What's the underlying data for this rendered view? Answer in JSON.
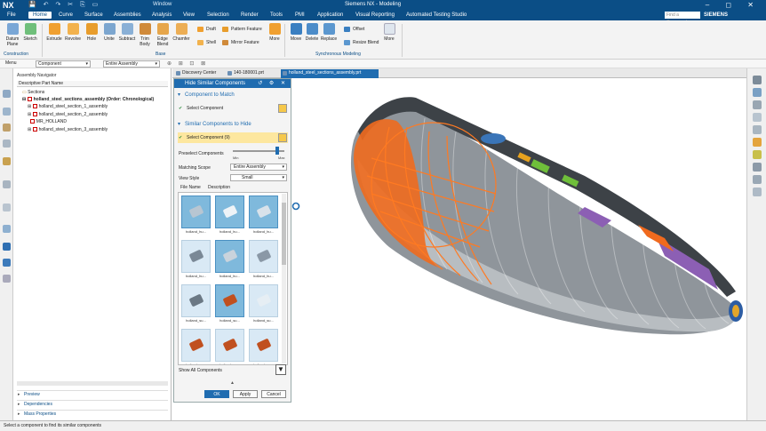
{
  "titlebar": {
    "logo": "NX",
    "window_menu": "Window",
    "title": "Siemens NX - Modeling",
    "controls": "– ◻ ✕"
  },
  "menubar": {
    "items": [
      "File",
      "Home",
      "Curve",
      "Surface",
      "Assemblies",
      "Analysis",
      "View",
      "Selection",
      "Render",
      "Tools",
      "PMI",
      "Application",
      "Visual Reporting",
      "Automated Testing Studio"
    ],
    "active": "Home",
    "search_placeholder": "Find a Command",
    "brand": "SIEMENS"
  },
  "ribbon": {
    "construction": {
      "label": "Construction",
      "items": [
        "Datum Plane",
        "Sketch"
      ]
    },
    "base": {
      "label": "Base",
      "items": [
        "Extrude",
        "Revolve",
        "Hole",
        "Unite",
        "Subtract",
        "Trim Body",
        "Edge Blend",
        "Chamfer"
      ],
      "small": [
        "Draft",
        "Shell",
        "Pattern Feature",
        "Mirror Feature"
      ],
      "more": "More"
    },
    "sync": {
      "label": "Synchronous Modeling",
      "items": [
        "Move",
        "Delete",
        "Replace"
      ],
      "small": [
        "Offset",
        "Resize Blend"
      ],
      "more": "More"
    },
    "colors": {
      "base": "#f0a030",
      "sync": "#3a7fc1"
    }
  },
  "toolbar2": {
    "menu_label": "Menu",
    "filter_value": "Component",
    "scope_value": "Entire Assembly"
  },
  "tabs": [
    {
      "label": "Discovery Center"
    },
    {
      "label": "140-180001.prt"
    },
    {
      "label": "holland_steel_sections_assembly.prt"
    }
  ],
  "navigator": {
    "title": "Assembly Navigator",
    "column": "Descriptive Part Name",
    "rows": [
      {
        "label": "Sections"
      },
      {
        "label": "holland_steel_sections_assembly (Order: Chronological)"
      },
      {
        "label": "holland_steel_section_1_assembly"
      },
      {
        "label": "holland_steel_section_2_assembly"
      },
      {
        "label": "MR_HOLLAND"
      },
      {
        "label": "holland_steel_section_3_assembly"
      }
    ],
    "sections": [
      "Preview",
      "Dependencies",
      "Mass Properties"
    ]
  },
  "dialog": {
    "title": "Hide Similar Components",
    "section1": "Component to Match",
    "select_component": "Select Component",
    "section2": "Similar Components to Hide",
    "select_component_count": "Select Component (9)",
    "preselect_label": "Preselect Components",
    "slider_min": "Min",
    "slider_max": "Max",
    "preselect_level": 0.85,
    "matching_scope_label": "Matching Scope",
    "matching_scope_value": "Entire Assembly",
    "view_style_label": "View Style",
    "view_style_value": "Small",
    "list_tabs": [
      "File Name",
      "Description"
    ],
    "thumbs": [
      {
        "caption": "holland_hu...",
        "selected": true
      },
      {
        "caption": "holland_hu...",
        "selected": true
      },
      {
        "caption": "holland_hu...",
        "selected": true
      },
      {
        "caption": "holland_hu...",
        "selected": false
      },
      {
        "caption": "holland_hu...",
        "selected": true
      },
      {
        "caption": "holland_hu...",
        "selected": false
      },
      {
        "caption": "holland_su...",
        "selected": false
      },
      {
        "caption": "holland_su...",
        "selected": true
      },
      {
        "caption": "holland_su...",
        "selected": false
      },
      {
        "caption": "holland_su...",
        "selected": false
      },
      {
        "caption": "holland_su...",
        "selected": false
      },
      {
        "caption": "holland_su...",
        "selected": false
      }
    ],
    "show_all": "Show All Components",
    "ok": "OK",
    "apply": "Apply",
    "cancel": "Cancel"
  },
  "status": "Select a component to find its similar components"
}
